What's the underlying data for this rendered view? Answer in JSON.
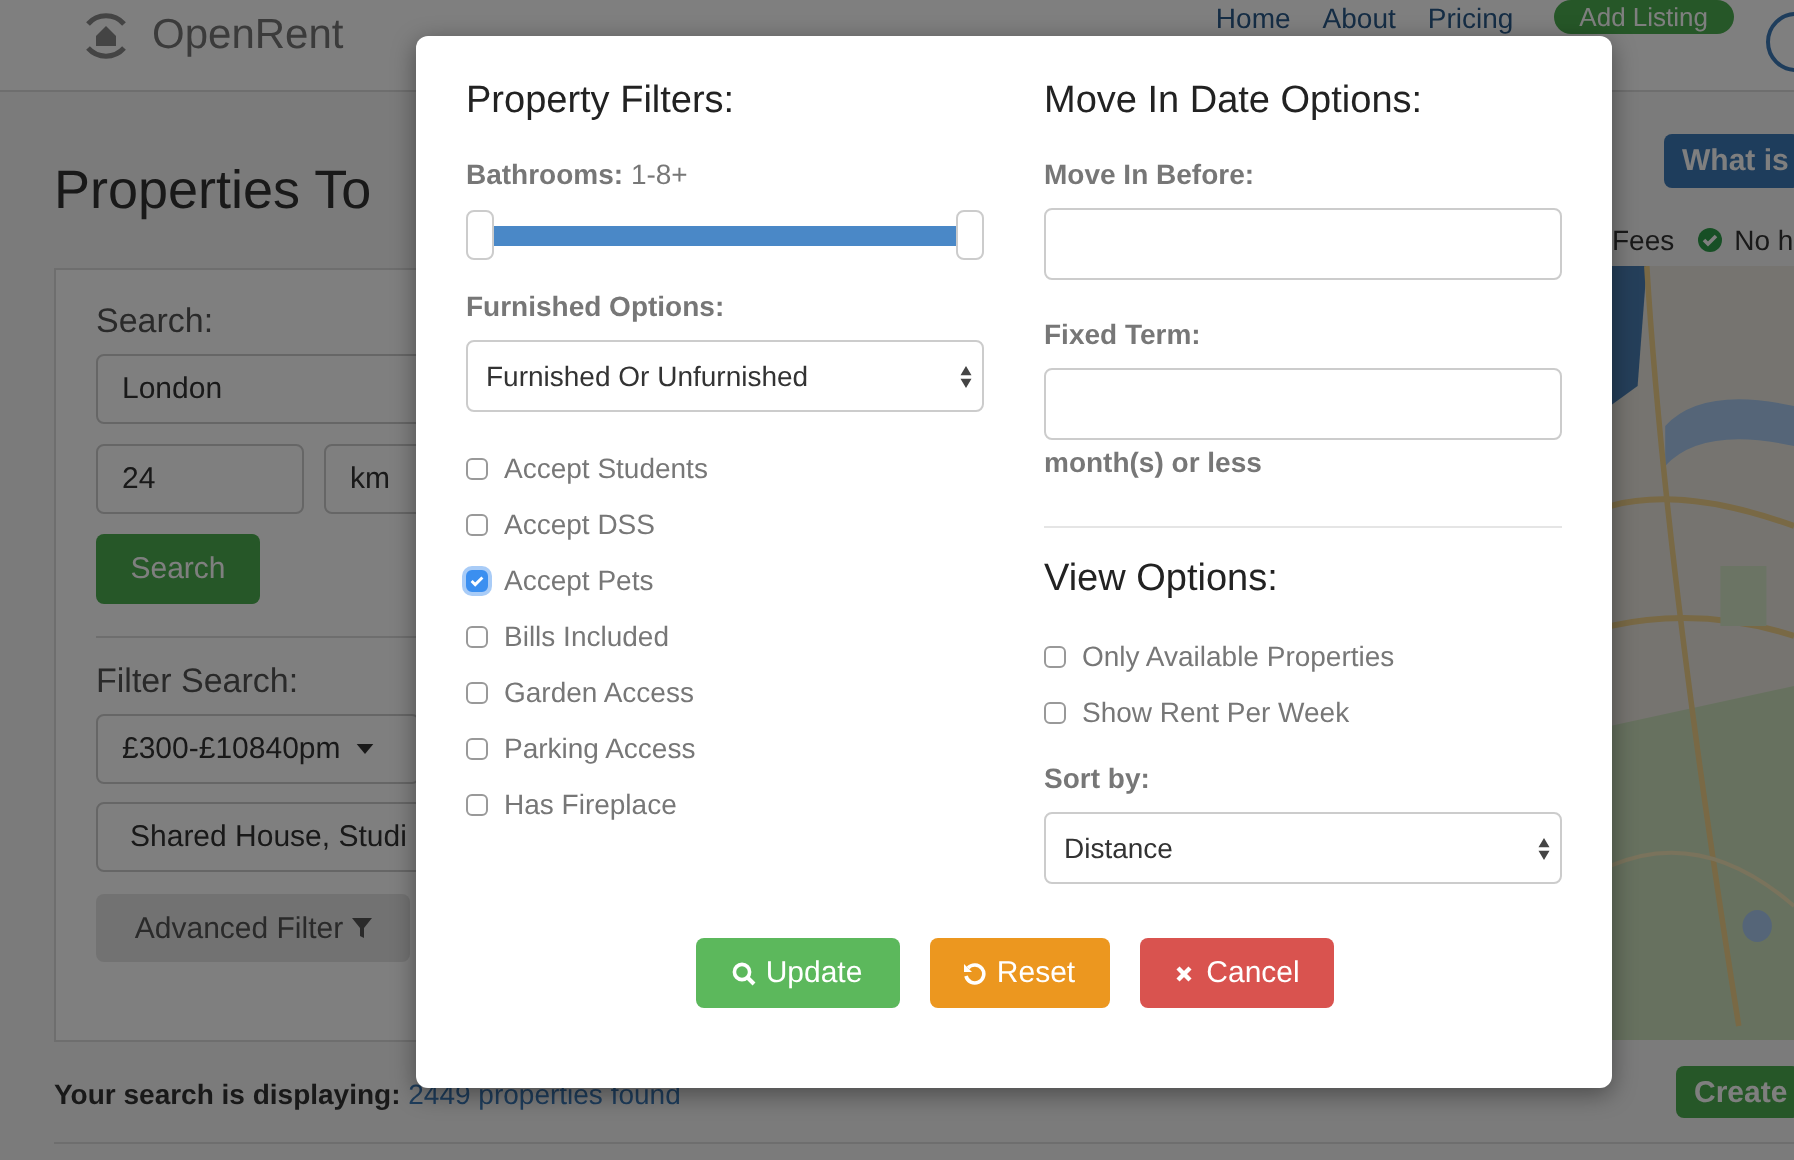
{
  "header": {
    "logo": "OpenRent",
    "nav": [
      "Home",
      "About",
      "Pricing"
    ],
    "add_listing": "Add Listing"
  },
  "page": {
    "title": "Properties To",
    "search_label": "Search:",
    "location": "London",
    "radius": "24",
    "unit": "km",
    "search_button": "Search",
    "filter_label": "Filter Search:",
    "price": "£300-£10840pm",
    "types": "Shared House, Studi",
    "advanced_filter": "Advanced Filter",
    "info_button": "What is",
    "features": [
      {
        "label": "Fees",
        "kind": "text"
      },
      {
        "label": "No h",
        "kind": "check"
      }
    ],
    "create_button": "Create",
    "results": {
      "prefix": "Your search is displaying:",
      "link": "2449 properties found"
    }
  },
  "modal": {
    "property_filters": {
      "title": "Property Filters:",
      "bathrooms": {
        "label": "Bathrooms:",
        "value": "1-8+",
        "thumbs": [
          {
            "level": 0
          },
          {
            "level": 1
          }
        ]
      },
      "furnished": {
        "label": "Furnished Options:",
        "value": "Furnished Or Unfurnished"
      },
      "options": [
        {
          "label": "Accept Students",
          "checked": false
        },
        {
          "label": "Accept DSS",
          "checked": false
        },
        {
          "label": "Accept Pets",
          "checked": true
        },
        {
          "label": "Bills Included",
          "checked": false
        },
        {
          "label": "Garden Access",
          "checked": false
        },
        {
          "label": "Parking Access",
          "checked": false
        },
        {
          "label": "Has Fireplace",
          "checked": false
        }
      ]
    },
    "move_in": {
      "title": "Move In Date Options:",
      "before_label": "Move In Before:",
      "fixed_term_label": "Fixed Term:",
      "fixed_term_suffix": "month(s) or less"
    },
    "view_options": {
      "title": "View Options:",
      "options": [
        {
          "label": "Only Available Properties",
          "checked": false
        },
        {
          "label": "Show Rent Per Week",
          "checked": false
        }
      ],
      "sort_label": "Sort by:",
      "sort_value": "Distance"
    },
    "buttons": [
      {
        "label": "Update",
        "kind": "update"
      },
      {
        "label": "Reset",
        "kind": "reset"
      },
      {
        "label": "Cancel",
        "kind": "cancel"
      }
    ]
  }
}
